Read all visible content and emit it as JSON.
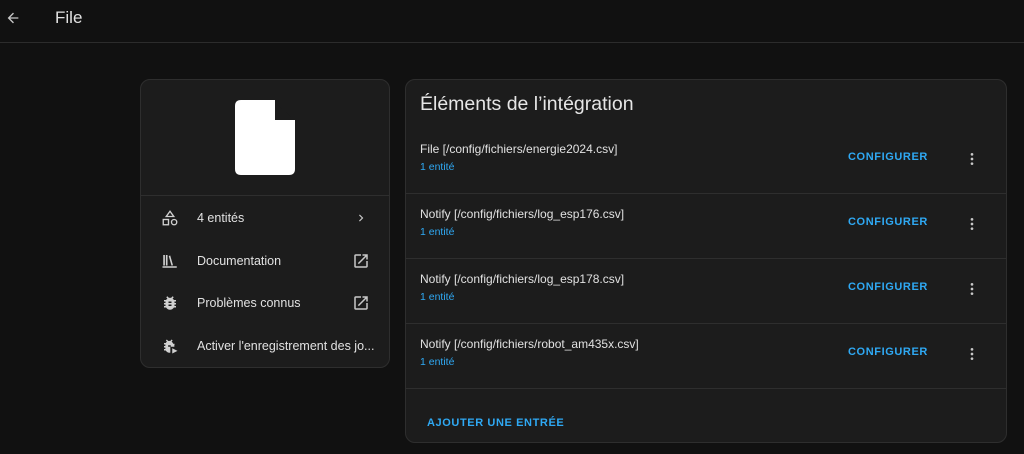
{
  "header": {
    "back_icon": "arrow-left-icon",
    "title": "File"
  },
  "info_card": {
    "logo_icon": "file-document-icon",
    "rows": [
      {
        "icon": "shapes-icon",
        "label": "4 entités",
        "trailing_icon": "chevron-right-icon"
      },
      {
        "icon": "bookshelf-icon",
        "label": "Documentation",
        "trailing_icon": "open-in-new-icon"
      },
      {
        "icon": "bug-icon",
        "label": "Problèmes connus",
        "trailing_icon": "open-in-new-icon"
      },
      {
        "icon": "bug-play-icon",
        "label": "Activer l'enregistrement des jo..."
      }
    ]
  },
  "entries_card": {
    "title": "Éléments de l’intégration",
    "entries": [
      {
        "title": "File [/config/fichiers/energie2024.csv]",
        "subtitle": "1 entité",
        "action": "CONFIGURER"
      },
      {
        "title": "Notify [/config/fichiers/log_esp176.csv]",
        "subtitle": "1 entité",
        "action": "CONFIGURER"
      },
      {
        "title": "Notify [/config/fichiers/log_esp178.csv]",
        "subtitle": "1 entité",
        "action": "CONFIGURER"
      },
      {
        "title": "Notify [/config/fichiers/robot_am435x.csv]",
        "subtitle": "1 entité",
        "action": "CONFIGURER"
      }
    ],
    "add_entry_label": "AJOUTER UNE ENTRÉE"
  },
  "colors": {
    "background": "#111111",
    "card": "#1c1c1c",
    "accent": "#2fa9f4",
    "text": "#e1e1e1"
  }
}
